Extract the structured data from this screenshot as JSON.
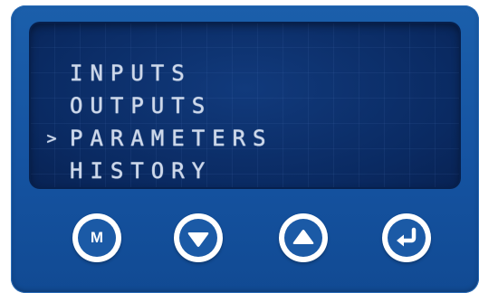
{
  "display": {
    "menu": [
      {
        "label": "INPUTS",
        "cursor": ""
      },
      {
        "label": "OUTPUTS",
        "cursor": ""
      },
      {
        "label": "PARAMETERS",
        "cursor": ">"
      },
      {
        "label": "HISTORY",
        "cursor": ""
      }
    ],
    "selected_index": 2
  },
  "buttons": {
    "menu_label": "M",
    "down_icon": "down-triangle-icon",
    "up_icon": "up-triangle-icon",
    "enter_icon": "enter-return-icon"
  },
  "colors": {
    "body": "#1553a1",
    "lcd_background": "#0b2e68",
    "lcd_text": "#cfd9ea",
    "button_ring": "#ffffff",
    "button_fill": "#1b5aa6"
  }
}
